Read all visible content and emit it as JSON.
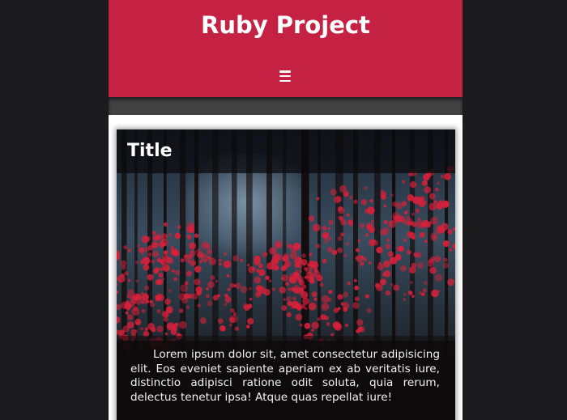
{
  "header": {
    "title": "Ruby Project",
    "menu_icon": "hamburger-menu-icon",
    "background_color": "#c42143"
  },
  "card": {
    "title": "Title",
    "image": "red-autumn-forest",
    "text": "Lorem ipsum dolor sit, amet consectetur adipisicing elit. Eos eveniet sapiente aperiam ex ab veritatis iure, distinctio adipisci ratione odit soluta, quia rerum, delectus tenetur ipsa! Atque quas repellat iure!"
  },
  "colors": {
    "page_background": "#1b1b1d",
    "subbar": "#424243",
    "foliage": "#d8203a"
  }
}
